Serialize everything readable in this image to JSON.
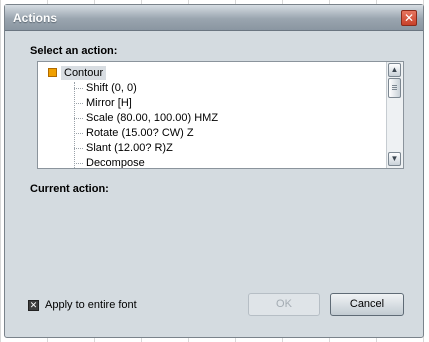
{
  "window": {
    "title": "Actions"
  },
  "labels": {
    "select_action": "Select an action:",
    "current_action": "Current action:"
  },
  "tree": {
    "root": "Contour",
    "items": [
      "Shift (0, 0)",
      "Mirror [H]",
      "Scale (80.00, 100.00) HMZ",
      "Rotate (15.00? CW) Z",
      "Slant (12.00? R)Z",
      "Decompose"
    ]
  },
  "footer": {
    "apply_label": "Apply to entire font",
    "apply_checked": true,
    "ok_label": "OK",
    "cancel_label": "Cancel"
  },
  "icons": {
    "close": "close-icon",
    "scroll_up": "chevron-up-icon",
    "scroll_down": "chevron-down-icon"
  },
  "colors": {
    "title_gradient_top": "#d6dde3",
    "dialog_bg": "#d4dbe0",
    "close_red": "#c8412a",
    "root_node": "#f0a000"
  }
}
